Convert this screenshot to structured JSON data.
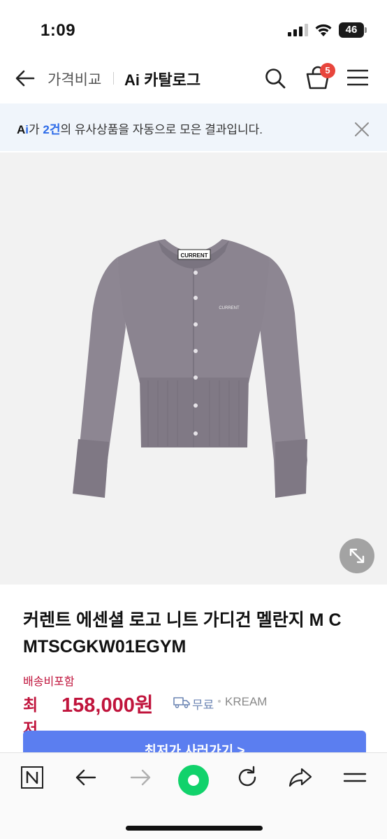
{
  "status_bar": {
    "time": "1:09",
    "battery_level": "46",
    "icons": [
      "cellular-signal-icon",
      "wifi-icon",
      "battery-icon"
    ]
  },
  "header": {
    "breadcrumb": "가격비교",
    "section_title": "Ai 카탈로그",
    "cart_count": "5",
    "icons": [
      "back-arrow-icon",
      "search-icon",
      "cart-icon",
      "hamburger-menu-icon"
    ]
  },
  "ai_banner": {
    "ai_prefix_a": "A",
    "ai_prefix_i": "i",
    "text_after_ai": "가 ",
    "count": "2건",
    "text_rest": "의 유사상품을 자동으로 모은 결과입니다.",
    "close_icon": "close-icon"
  },
  "product": {
    "image_label": "CURRENT",
    "chest_logo": "CURRENT",
    "title_line1": "커렌트 에센셜 로고 니트 가디건 멜란지 M C",
    "title_line2": "MTSCGKW01EGYM",
    "shipping_note": "배송비포함",
    "price_label": "최저",
    "price": "158,000원",
    "delivery_label": "무료",
    "seller": "KREAM",
    "buy_button": "최저가 사러가기 >"
  },
  "toolbar": {
    "icons": [
      "naver-n-icon",
      "back-icon",
      "forward-icon",
      "green-home-icon",
      "refresh-icon",
      "share-icon",
      "menu-lines-icon"
    ]
  },
  "colors": {
    "accent_blue": "#2d6be8",
    "price_red": "#c0143c",
    "buy_button": "#5b7ef0",
    "badge_red": "#e8453c",
    "banner_bg": "#f0f5fb",
    "cardigan_gray": "#8b8490"
  }
}
